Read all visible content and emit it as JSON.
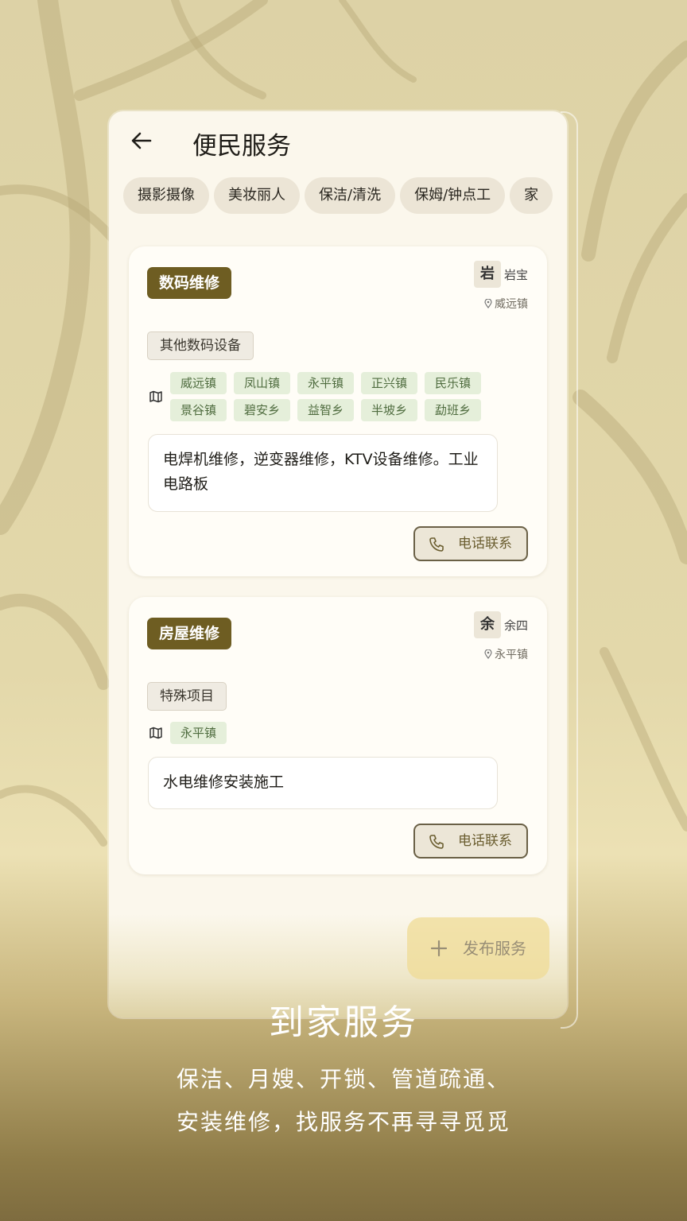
{
  "header": {
    "title": "便民服务"
  },
  "tabs": [
    "摄影摄像",
    "美妆丽人",
    "保洁/清洗",
    "保姆/钟点工",
    "家"
  ],
  "cards": [
    {
      "category": "数码维修",
      "avatar": "岩",
      "author": "岩宝",
      "location": "威远镇",
      "subtag": "其他数码设备",
      "regions": [
        "威远镇",
        "凤山镇",
        "永平镇",
        "正兴镇",
        "民乐镇",
        "景谷镇",
        "碧安乡",
        "益智乡",
        "半坡乡",
        "勐班乡"
      ],
      "description": "电焊机维修，逆变器维修，KTV设备维修。工业电路板",
      "call_label": "电话联系"
    },
    {
      "category": "房屋维修",
      "avatar": "余",
      "author": "余四",
      "location": "永平镇",
      "subtag": "特殊项目",
      "regions": [
        "永平镇"
      ],
      "description": "水电维修安装施工",
      "call_label": "电话联系"
    }
  ],
  "fab": {
    "label": "发布服务"
  },
  "promo": {
    "title": "到家服务",
    "line1": "保洁、月嫂、开锁、管道疏通、",
    "line2": "安装维修，找服务不再寻寻觅觅"
  },
  "colors": {
    "accent": "#6e5d22",
    "region_bg": "#e5efda",
    "fab": "#f0dc96"
  }
}
